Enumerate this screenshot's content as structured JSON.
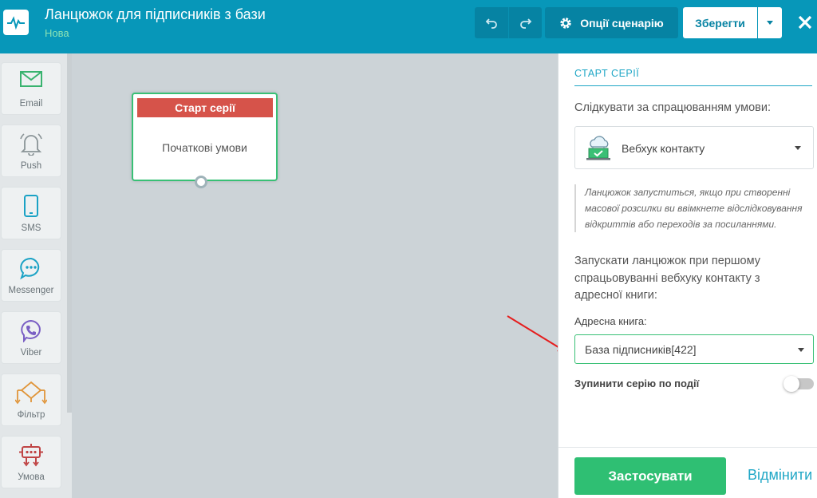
{
  "header": {
    "title": "Ланцюжок для підписників з бази",
    "status": "Нова",
    "options_label": "Опції сценарію",
    "save_label": "Зберегти"
  },
  "toolbar": {
    "items": [
      {
        "label": "Email",
        "icon": "envelope-icon",
        "color": "#39b36f"
      },
      {
        "label": "Push",
        "icon": "bell-icon",
        "color": "#8a9497"
      },
      {
        "label": "SMS",
        "icon": "phone-icon",
        "color": "#1aa2c5"
      },
      {
        "label": "Messenger",
        "icon": "chat-bubble-icon",
        "color": "#1aa2c5"
      },
      {
        "label": "Viber",
        "icon": "viber-icon",
        "color": "#7a5fc4"
      },
      {
        "label": "Фільтр",
        "icon": "filter-diamond-icon",
        "color": "#e0953a"
      },
      {
        "label": "Умова",
        "icon": "condition-robot-icon",
        "color": "#c04545"
      }
    ]
  },
  "canvas": {
    "node": {
      "header": "Старт серії",
      "body": "Початкові умови"
    }
  },
  "panel": {
    "title": "СТАРТ СЕРІЇ",
    "follow_label": "Слідкувати за спрацюванням умови:",
    "trigger_value": "Вебхук контакту",
    "note": "Ланцюжок запуститься, якщо при створенні масової розсилки ви ввімкнете відслідковування відкриттів або переходів за посиланнями.",
    "launch_text": "Запускати ланцюжок при першому спрацьовуванні вебхуку контакту з адресної книги:",
    "book_label": "Адресна книга:",
    "book_value": "База підписників[422]",
    "stop_label": "Зупинити серію по події",
    "apply_label": "Застосувати",
    "cancel_label": "Відмінити"
  },
  "colors": {
    "header_bg": "#0797b9",
    "accent_green": "#2fbf73",
    "accent_blue": "#20a7c6",
    "node_header": "#d6534a"
  }
}
